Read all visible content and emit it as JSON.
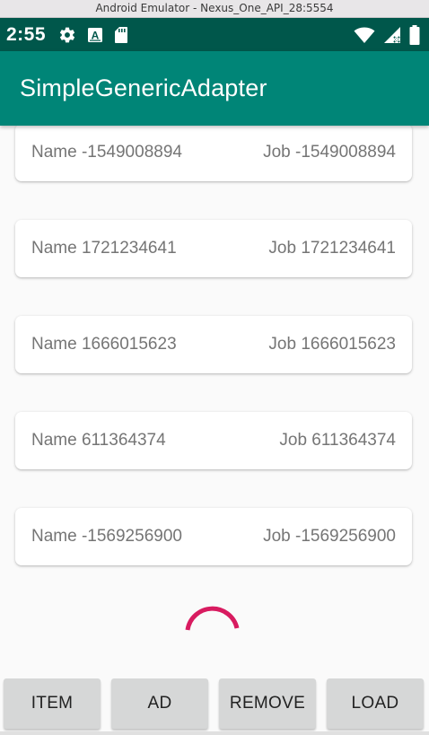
{
  "window": {
    "title": "Android Emulator - Nexus_One_API_28:5554"
  },
  "status_bar": {
    "time": "2:55",
    "left_icons": [
      "gear-icon",
      "font-icon",
      "sd-card-icon"
    ],
    "font_icon_letter": "A",
    "right_icons": [
      "wifi-icon",
      "signal-icon",
      "battery-icon"
    ]
  },
  "app_bar": {
    "title": "SimpleGenericAdapter",
    "color": "#008577",
    "status_color": "#00574b"
  },
  "list": {
    "items": [
      {
        "name": "Name -1549008894",
        "job": "Job -1549008894"
      },
      {
        "name": "Name 1721234641",
        "job": "Job 1721234641"
      },
      {
        "name": "Name 1666015623",
        "job": "Job 1666015623"
      },
      {
        "name": "Name 611364374",
        "job": "Job 611364374"
      },
      {
        "name": "Name -1569256900",
        "job": "Job -1569256900"
      }
    ],
    "loading": true,
    "spinner_color": "#d81b60"
  },
  "buttons": {
    "item": "ITEM",
    "ad": "AD",
    "remove": "REMOVE",
    "load": "LOAD"
  }
}
